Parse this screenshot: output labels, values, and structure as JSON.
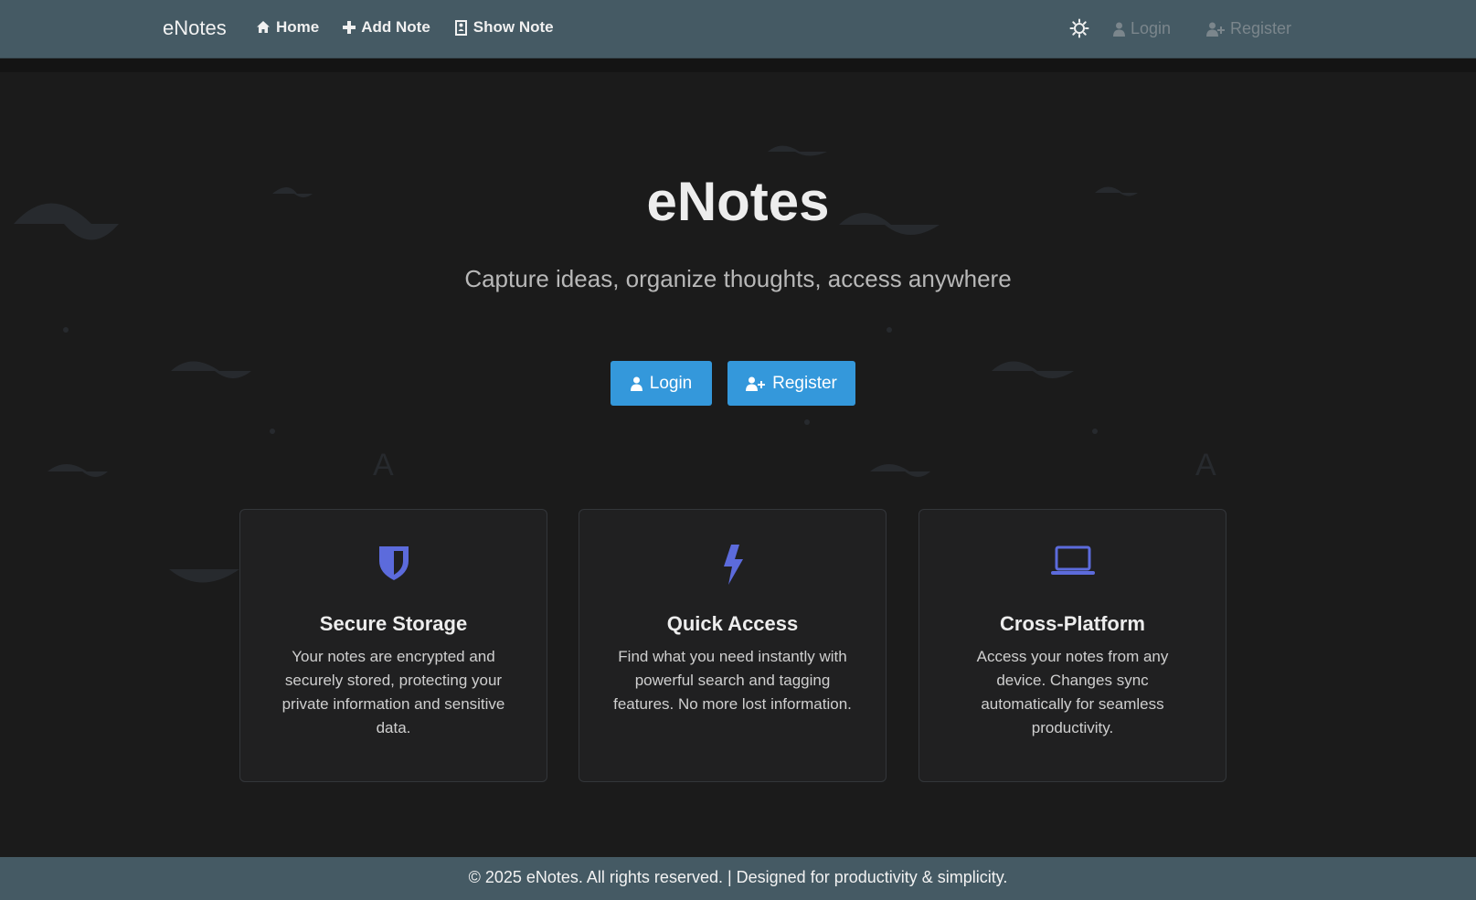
{
  "navbar": {
    "brand": "eNotes",
    "links": [
      {
        "label": "Home",
        "icon": "home-icon"
      },
      {
        "label": "Add Note",
        "icon": "plus-icon"
      },
      {
        "label": "Show Note",
        "icon": "note-icon"
      }
    ],
    "theme_icon": "sun-icon",
    "login_label": "Login",
    "register_label": "Register"
  },
  "hero": {
    "title": "eNotes",
    "subtitle": "Capture ideas, organize thoughts, access anywhere",
    "login_button": "Login",
    "register_button": "Register"
  },
  "features": [
    {
      "icon": "shield-icon",
      "title": "Secure Storage",
      "text": "Your notes are encrypted and securely stored, protecting your private information and sensitive data."
    },
    {
      "icon": "bolt-icon",
      "title": "Quick Access",
      "text": "Find what you need instantly with powerful search and tagging features. No more lost information."
    },
    {
      "icon": "laptop-icon",
      "title": "Cross-Platform",
      "text": "Access your notes from any device. Changes sync automatically for seamless productivity."
    }
  ],
  "footer": {
    "text": "© 2025 eNotes. All rights reserved. | Designed for productivity & simplicity."
  },
  "colors": {
    "navbar": "#455a64",
    "background": "#1b1b1b",
    "primary_button": "#3498db",
    "feature_icon": "#5c6bdc"
  }
}
